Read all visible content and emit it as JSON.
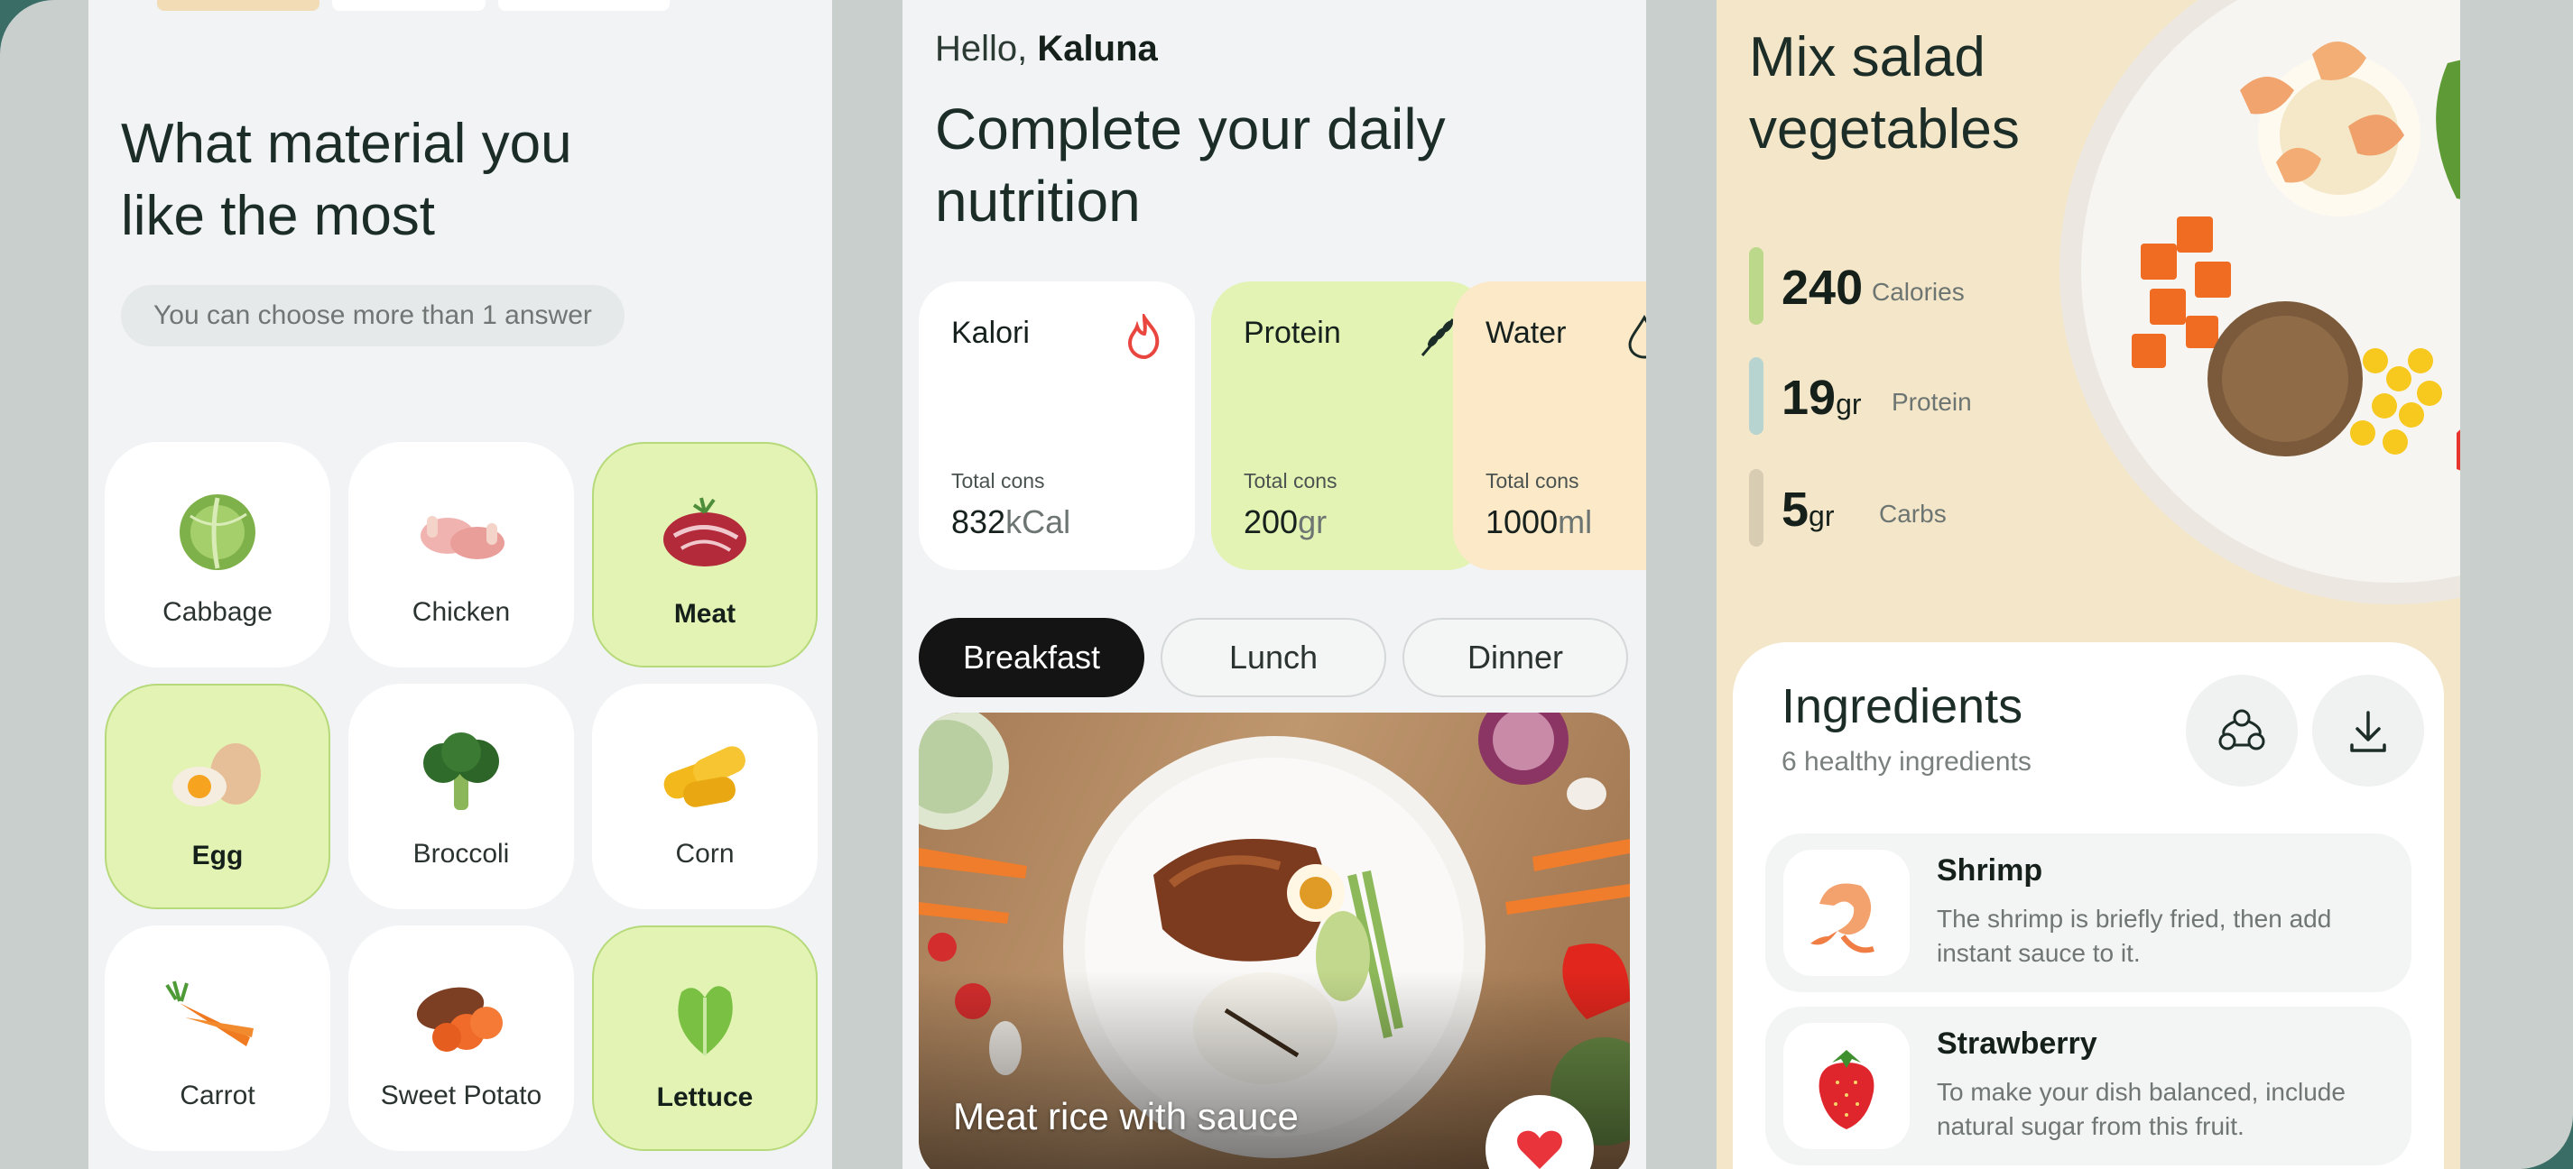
{
  "screen1": {
    "title_line1": "What material you",
    "title_line2": "like the most",
    "hint": "You can choose more than 1 answer",
    "items": [
      {
        "label": "Cabbage",
        "icon": "cabbage-icon",
        "selected": false
      },
      {
        "label": "Chicken",
        "icon": "chicken-icon",
        "selected": false
      },
      {
        "label": "Meat",
        "icon": "meat-icon",
        "selected": true
      },
      {
        "label": "Egg",
        "icon": "egg-icon",
        "selected": true
      },
      {
        "label": "Broccoli",
        "icon": "broccoli-icon",
        "selected": false
      },
      {
        "label": "Corn",
        "icon": "corn-icon",
        "selected": false
      },
      {
        "label": "Carrot",
        "icon": "carrot-icon",
        "selected": false
      },
      {
        "label": "Sweet Potato",
        "icon": "sweet-potato-icon",
        "selected": false
      },
      {
        "label": "Lettuce",
        "icon": "lettuce-icon",
        "selected": true
      }
    ]
  },
  "screen2": {
    "greeting": "Hello,",
    "user_name": "Kaluna",
    "title_line1": "Complete your daily",
    "title_line2": "nutrition",
    "cards": [
      {
        "title": "Kalori",
        "sub": "Total cons",
        "value": "832",
        "unit": "kCal",
        "icon": "flame-icon",
        "color": "#ffffff"
      },
      {
        "title": "Protein",
        "sub": "Total cons",
        "value": "200",
        "unit": "gr",
        "icon": "wheat-icon",
        "color": "#e3f3b4"
      },
      {
        "title": "Water",
        "sub": "Total cons",
        "value": "1000",
        "unit": "ml",
        "icon": "drop-icon",
        "color": "#fbe9c8"
      }
    ],
    "tabs": [
      "Breakfast",
      "Lunch",
      "Dinner"
    ],
    "active_tab": "Breakfast",
    "dish_title": "Meat rice with sauce"
  },
  "screen3": {
    "title_line1": "Mix salad",
    "title_line2": "vegetables",
    "stats": [
      {
        "value": "240",
        "unit": "",
        "label": "Calories",
        "color": "#bcd88a"
      },
      {
        "value": "19",
        "unit": "gr",
        "label": "Protein",
        "color": "#b7d4d1"
      },
      {
        "value": "5",
        "unit": "gr",
        "label": "Carbs",
        "color": "#d8ccb3"
      }
    ],
    "ingredients_title": "Ingredients",
    "ingredients_sub": "6 healthy ingredients",
    "ingredients": [
      {
        "name": "Shrimp",
        "desc": "The shrimp is briefly fried, then add instant sauce to it."
      },
      {
        "name": "Strawberry",
        "desc": "To make your dish balanced, include natural sugar from this fruit."
      }
    ]
  },
  "colors": {
    "accent_green": "#e3f3b4",
    "accent_peach": "#f4e6c9",
    "frame": "#3a6d66"
  }
}
